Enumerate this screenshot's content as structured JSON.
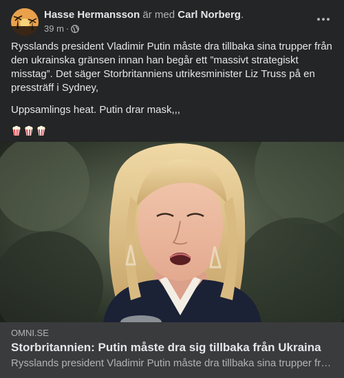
{
  "post": {
    "author": "Hasse Hermansson",
    "with_text": "är med",
    "friend": "Carl Norberg",
    "friend_suffix": ".",
    "time": "39 m",
    "separator": "·",
    "privacy_icon": "globe-icon",
    "more_icon": "more-options-icon",
    "paragraphs": [
      "Rysslands president Vladimir Putin måste dra tillbaka sina trupper från den ukrainska gränsen innan han begår ett ”massivt strategiskt misstag”. Det säger Storbritanniens utrikesminister Liz Truss på en pressträff i Sydney,",
      "Uppsamlings heat. Putin drar mask,,,"
    ],
    "emojis": [
      "popcorn-icon",
      "popcorn-icon",
      "popcorn-icon"
    ]
  },
  "link_preview": {
    "domain": "OMNI.SE",
    "title": "Storbritannien: Putin måste dra sig tillbaka från Ukraina",
    "description": "Rysslands president Vladimir Putin måste dra tillbaka sina trupper från den ukrainska gränsen"
  },
  "colors": {
    "background": "#242526",
    "preview_background": "#3a3b3c",
    "primary_text": "#e4e6eb",
    "secondary_text": "#b0b3b8"
  }
}
